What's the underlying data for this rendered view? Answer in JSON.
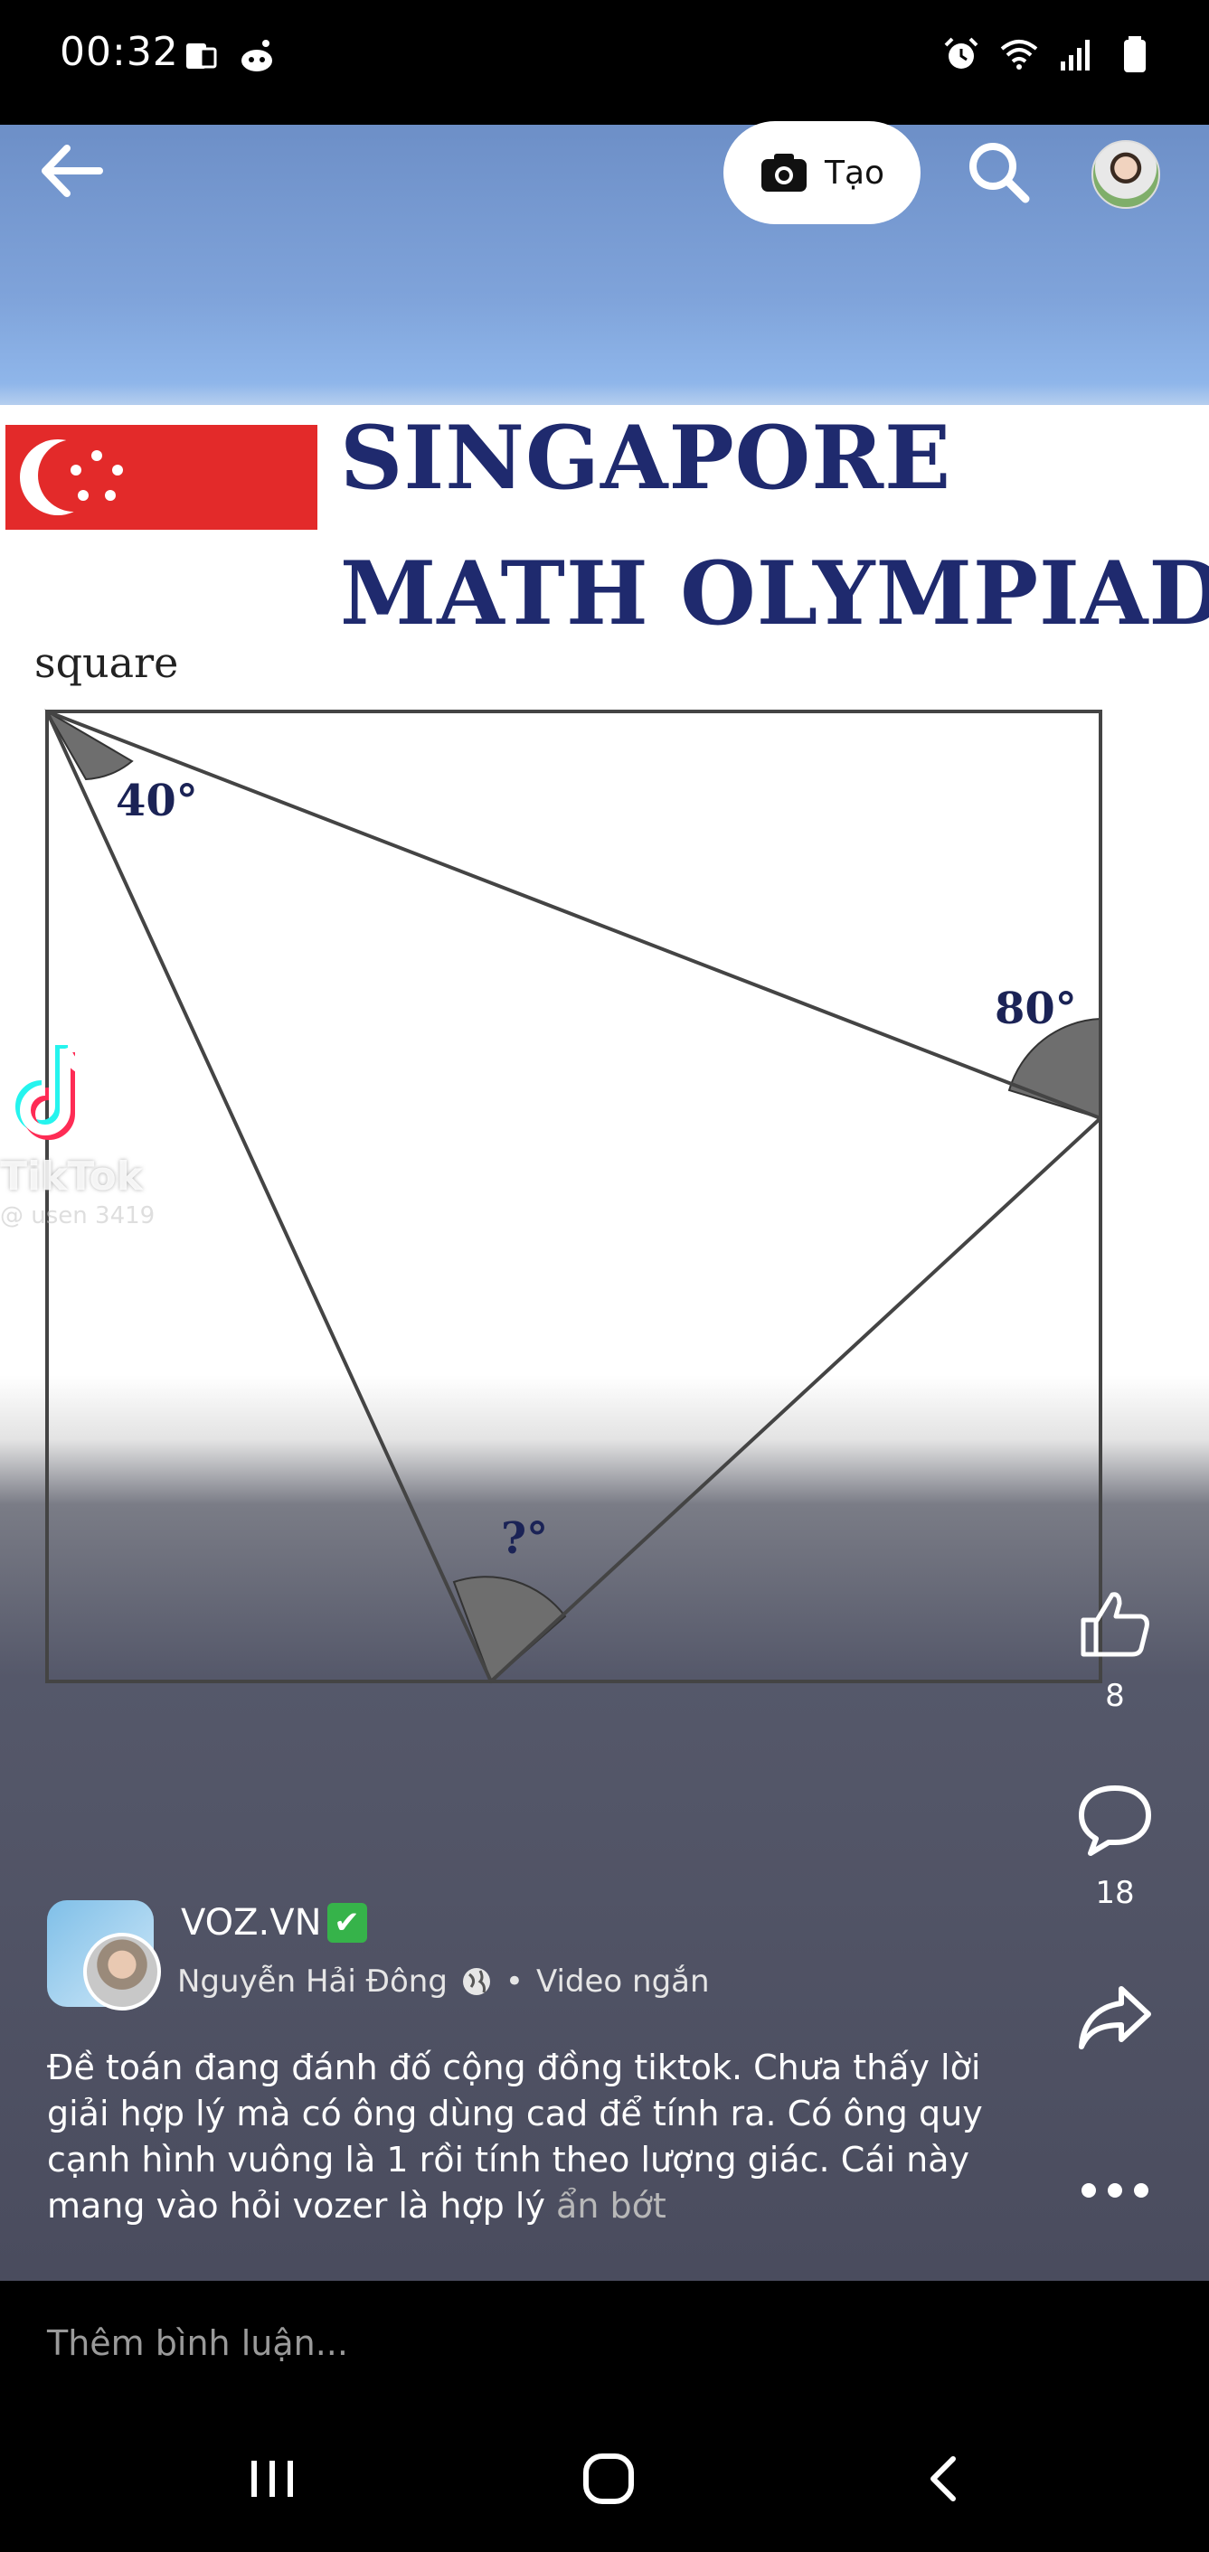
{
  "status_bar": {
    "time": "00:32",
    "left_icons": [
      "screen-cast-icon",
      "reddit-icon"
    ],
    "right_icons": [
      "alarm-icon",
      "wifi-icon",
      "signal-icon",
      "battery-icon"
    ]
  },
  "top_bar": {
    "back_icon": "arrow-left-icon",
    "create_label": "Tạo",
    "create_icon": "camera-icon",
    "search_icon": "search-icon",
    "profile_icon": "avatar"
  },
  "video": {
    "banner_line1": "SINGAPORE",
    "banner_line2": "MATH OLYMPIAD",
    "figure_label": "square",
    "angle_top_left": "40°",
    "angle_right": "80°",
    "angle_bottom": "?°",
    "watermark_app": "TikTok",
    "watermark_user": "@ usen 3419"
  },
  "actions": {
    "like_count": "8",
    "comment_count": "18",
    "share_icon": "share-icon",
    "more_icon": "more-icon"
  },
  "post": {
    "page_name": "VOZ.VN",
    "verified_mark": "✔",
    "author": "Nguyễn Hải Đông",
    "type": "Video ngắn",
    "separator": "•",
    "caption": "Đề toán đang đánh đố cộng đồng tiktok. Chưa thấy lời giải hợp lý mà có ông dùng cad để tính ra. Có ông quy cạnh hình vuông là 1 rồi tính theo lượng giác. Cái này mang vào hỏi vozer là hợp lý",
    "see_less": "ẩn bớt"
  },
  "comment_input": {
    "placeholder": "Thêm bình luận..."
  },
  "nav": {
    "buttons": [
      "recent-apps-icon",
      "home-icon",
      "back-icon"
    ]
  },
  "colors": {
    "banner_title": "#1f2a6e",
    "flag_red": "#e32a2a",
    "verified_green": "#36b34a"
  }
}
